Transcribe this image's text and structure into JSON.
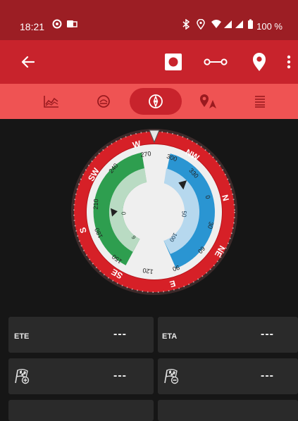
{
  "status_bar": {
    "time": "18:21",
    "battery_text": "100 %",
    "icons": [
      "circle-status-icon",
      "outlook-icon",
      "bluetooth-icon",
      "location-icon",
      "wifi-icon",
      "signal-icon",
      "signal-icon",
      "battery-icon"
    ]
  },
  "app_bar": {
    "icons": [
      "back-arrow-icon",
      "record-icon",
      "route-icon",
      "map-pin-icon",
      "more-vert-icon"
    ]
  },
  "tabs": [
    {
      "icon": "chart-icon",
      "active": false
    },
    {
      "icon": "gauge-icon",
      "active": false
    },
    {
      "icon": "compass-icon",
      "active": true
    },
    {
      "icon": "waypoint-navigation-icon",
      "active": false
    },
    {
      "icon": "list-icon",
      "active": false
    }
  ],
  "compass": {
    "cardinals": [
      "W",
      "NW",
      "N",
      "NE",
      "E",
      "SE",
      "S",
      "SW"
    ],
    "degree_labels": [
      "270",
      "300",
      "330",
      "0",
      "30",
      "60",
      "90",
      "120",
      "150",
      "180",
      "210",
      "240"
    ],
    "port_scale_labels": [
      "0",
      "6"
    ],
    "starboard_scale_labels": [
      "50",
      "100"
    ],
    "colors": {
      "ring": "#d62027",
      "port": "#2e9e4f",
      "starboard": "#2a95d2",
      "face": "#f1f1f1"
    }
  },
  "panels": [
    {
      "label": "ETE",
      "value": "---"
    },
    {
      "label": "ETA",
      "value": "---"
    },
    {
      "icon": "flag-add-icon",
      "value": "---"
    },
    {
      "icon": "flag-remove-icon",
      "value": "---"
    }
  ]
}
